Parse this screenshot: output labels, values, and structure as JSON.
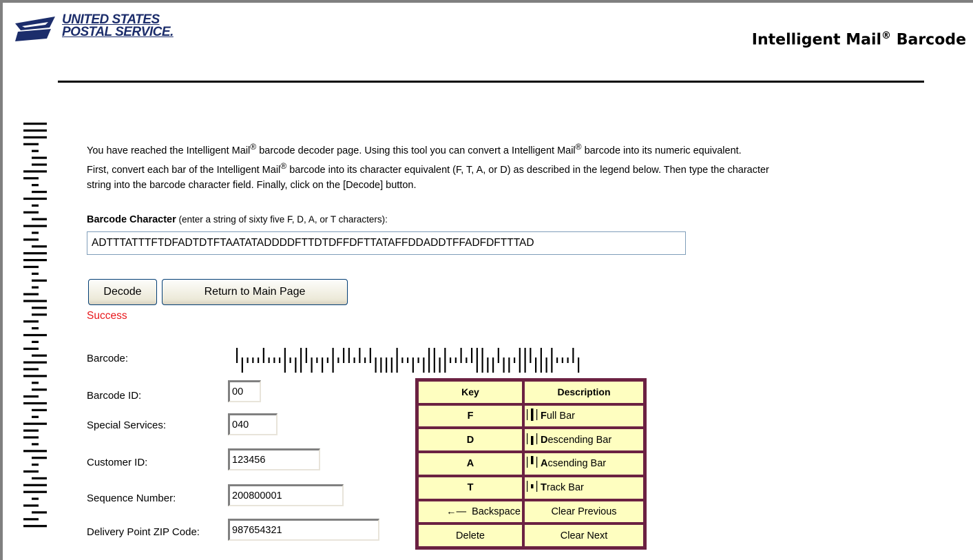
{
  "header": {
    "logo_line1": "UNITED STATES",
    "logo_line2": "POSTAL SERVICE.",
    "title": "Intelligent Mail",
    "title_mark": "®",
    "title_suffix": " Barcode"
  },
  "intro": {
    "p1a": "You have reached the Intelligent Mail",
    "p1b": " barcode decoder page. Using this tool you can convert a Intelligent Mail",
    "p1c": " barcode into its numeric equivalent.",
    "p2a": "First, convert each bar of the Intelligent Mail",
    "p2b": " barcode into its character equivalent (F, T, A, or D) as described in the legend below. Then type the character",
    "p2c": "string into the barcode character field. Finally, click on the [Decode] button.",
    "reg": "®"
  },
  "barcode_field": {
    "label": "Barcode Character",
    "hint": " (enter a string of sixty five F, D, A, or T characters):",
    "value": "ADTTTATTTFTDFADTDTFTAATATADDDDFTTDTDFFDFTTATAFFDDADDTFFADFDFTTTAD"
  },
  "buttons": {
    "decode": "Decode",
    "return": "Return to Main Page"
  },
  "status": "Success",
  "results": {
    "barcode_label": "Barcode:",
    "barcode_id_label": "Barcode ID:",
    "barcode_id": "00",
    "special_services_label": "Special Services:",
    "special_services": "040",
    "customer_id_label": "Customer ID:",
    "customer_id": "123456",
    "sequence_label": "Sequence Number:",
    "sequence": "200800001",
    "zip_label": "Delivery Point ZIP Code:",
    "zip": "987654321"
  },
  "legend": {
    "key_header": "Key",
    "desc_header": "Description",
    "rows": [
      {
        "key": "F",
        "initial": "F",
        "rest": "ull Bar",
        "bar": "full"
      },
      {
        "key": "D",
        "initial": "D",
        "rest": "escending Bar",
        "bar": "descending"
      },
      {
        "key": "A",
        "initial": "A",
        "rest": "csending Bar",
        "bar": "ascending"
      },
      {
        "key": "T",
        "initial": "T",
        "rest": "rack Bar",
        "bar": "track"
      }
    ],
    "backspace": "Backspace",
    "clear_previous": "Clear Previous",
    "delete": "Delete",
    "clear_next": "Clear Next"
  },
  "colors": {
    "brand_navy": "#1c2d6b",
    "status_red": "#e8161a",
    "legend_border": "#6b2142",
    "legend_cell": "#fefec0"
  }
}
